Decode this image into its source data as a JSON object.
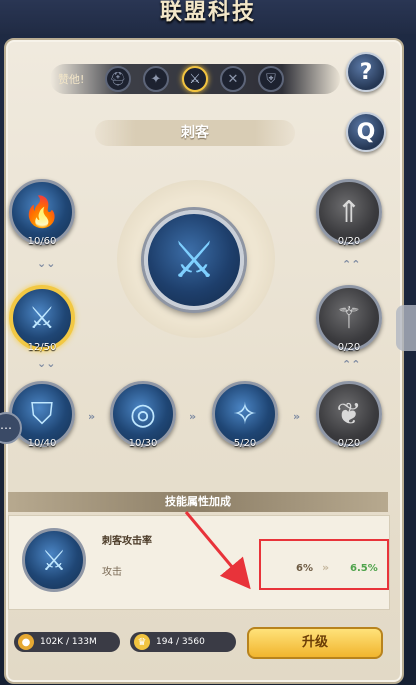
{
  "header": {
    "title": "联盟科技"
  },
  "tabs": {
    "label": "赞他!",
    "items": [
      {
        "icon": "helmet-icon",
        "glyph": "⛑",
        "active": false
      },
      {
        "icon": "mage-icon",
        "glyph": "✦",
        "active": false
      },
      {
        "icon": "crossed-swords-icon",
        "glyph": "⚔",
        "active": true
      },
      {
        "icon": "archer-icon",
        "glyph": "✕",
        "active": false
      },
      {
        "icon": "shield-icon",
        "glyph": "⛨",
        "active": false
      }
    ]
  },
  "buttons": {
    "help": "?",
    "refresh": "Q"
  },
  "class_name": "刺客",
  "center": {
    "glyph": "⚔"
  },
  "nodes": [
    {
      "name": "flame-skill-node",
      "glyph": "🔥",
      "label": "10/60",
      "style": "blue"
    },
    {
      "name": "swords-skill-node",
      "glyph": "⚔",
      "label": "12/50",
      "style": "blue",
      "selected": true
    },
    {
      "name": "shield-skill-node",
      "glyph": "⛉",
      "label": "10/40",
      "style": "blue"
    },
    {
      "name": "target-skill-node",
      "glyph": "◎",
      "label": "10/30",
      "style": "blue"
    },
    {
      "name": "crystal-skill-node",
      "glyph": "✧",
      "label": "5/20",
      "style": "blue"
    },
    {
      "name": "wing-skill-node",
      "glyph": "❦",
      "label": "0/20",
      "style": "grey"
    },
    {
      "name": "axe-skill-node",
      "glyph": "⚚",
      "label": "0/20",
      "style": "grey"
    },
    {
      "name": "arrows-skill-node",
      "glyph": "⇑",
      "label": "0/20",
      "style": "grey"
    }
  ],
  "attributes": {
    "title": "技能属性加成",
    "skill_name": "刺客攻击率",
    "stat": "攻击",
    "current": "6%",
    "next": "6.5%"
  },
  "resources": {
    "gold": "102K / 133M",
    "crystal": "194 / 3560"
  },
  "upgrade_label": "升级",
  "colors": {
    "accent_gold": "#f2c843",
    "next_value": "#4fa34c",
    "annotation": "#e8333a"
  }
}
